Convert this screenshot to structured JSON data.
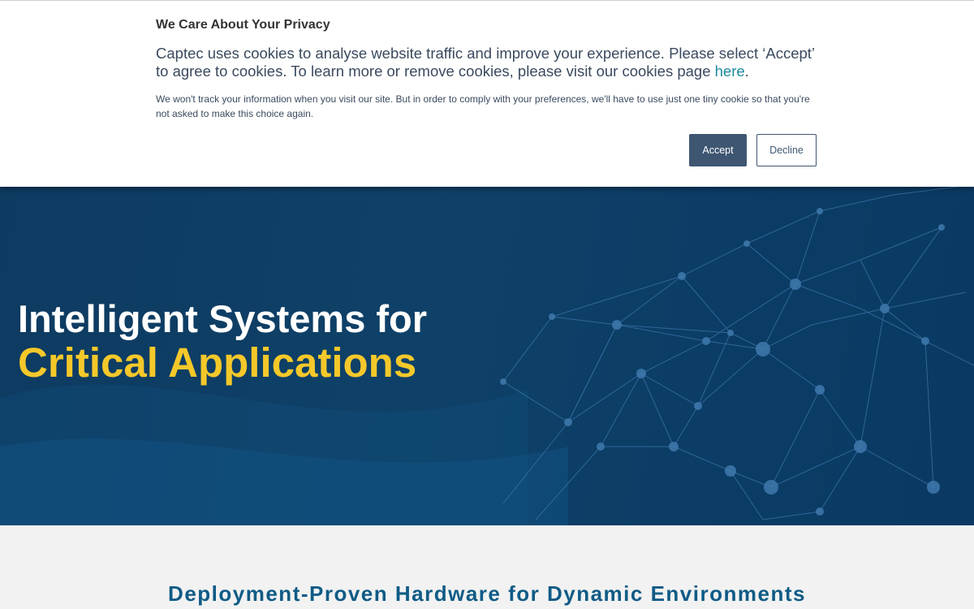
{
  "cookie_banner": {
    "title": "We Care About Your Privacy",
    "main_text": "Captec uses cookies to analyse website traffic and improve your experience. Please select ‘Accept’ to agree to cookies. To learn more or remove cookies, please visit our cookies page ",
    "link_text": "here",
    "main_text_end": ".",
    "small_text": "We won't track your information when you visit our site. But in order to comply with your preferences, we'll have to use just one tiny cookie so that you're not asked to make this choice again.",
    "accept_label": "Accept",
    "decline_label": "Decline"
  },
  "hero": {
    "title_line1": "Intelligent Systems for",
    "title_line2": "Critical Applications"
  },
  "section": {
    "heading": "Deployment-Proven Hardware for Dynamic Environments"
  },
  "colors": {
    "hero_background": "#0f4168",
    "accent_yellow": "#f5c82a",
    "button_primary": "#3e5672",
    "link": "#1c8aa0",
    "section_heading": "#0f5b86"
  }
}
